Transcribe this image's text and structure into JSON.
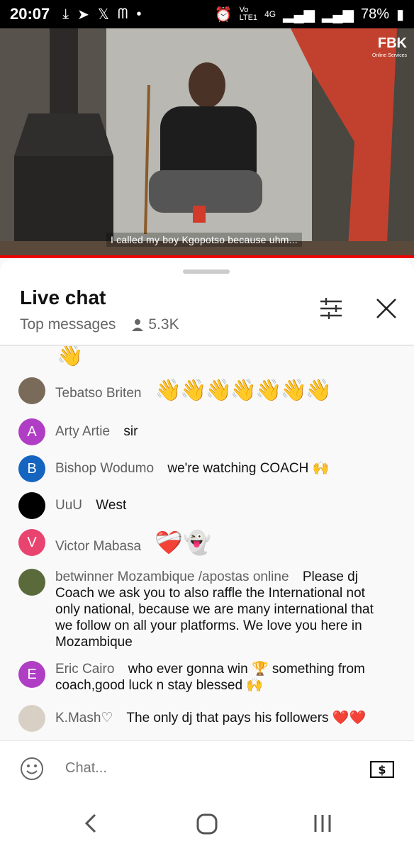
{
  "status": {
    "time": "20:07",
    "battery": "78%",
    "net": "4G"
  },
  "video": {
    "caption": "I called my boy Kgopotso because uhm...",
    "brand": "FBK",
    "brand_sub": "Online Services"
  },
  "chat": {
    "title": "Live chat",
    "mode": "Top messages",
    "viewers": "5.3K",
    "messages": [
      {
        "author": "Tebatso Briten",
        "text": "",
        "avatar_letter": "",
        "avatar_color": "#7a6a5a"
      },
      {
        "author": "Arty Artie",
        "text": "sir",
        "avatar_letter": "A",
        "avatar_color": "#b03ec5"
      },
      {
        "author": "Bishop Wodumo",
        "text": "we're watching COACH 🙌",
        "avatar_letter": "B",
        "avatar_color": "#1565c0"
      },
      {
        "author": "UuU",
        "text": "West",
        "avatar_letter": "",
        "avatar_color": "#000000"
      },
      {
        "author": "Victor Mabasa",
        "text": "",
        "avatar_letter": "V",
        "avatar_color": "#e9436f"
      },
      {
        "author": "betwinner Mozambique /apostas online",
        "text": "Please dj Coach we ask you to also raffle the International not only national, because we are many international that we follow on all your platforms. We love you here in Mozambique",
        "avatar_letter": "",
        "avatar_color": "#5a6a3a"
      },
      {
        "author": "Eric Cairo",
        "text": "who ever gonna win 🏆 something from coach,good luck n stay blessed 🙌",
        "avatar_letter": "E",
        "avatar_color": "#b03ec5"
      },
      {
        "author": "K.Mash♡",
        "text": "The only dj that pays his followers ❤️❤️",
        "avatar_letter": "",
        "avatar_color": "#d8d0c4"
      }
    ],
    "input_placeholder": "Chat..."
  },
  "icons": {
    "emoji": "emoji-icon",
    "super_chat": "super-chat-icon"
  }
}
